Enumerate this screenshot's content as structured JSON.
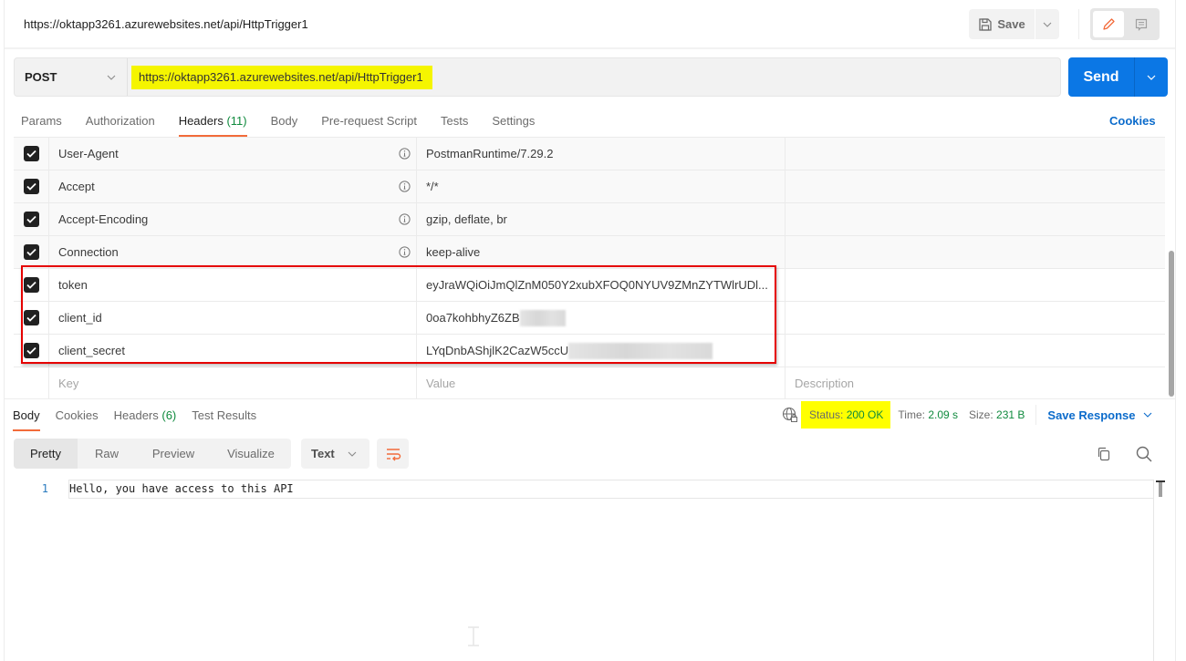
{
  "request": {
    "title": "https://oktapp3261.azurewebsites.net/api/HttpTrigger1",
    "method": "POST",
    "url": "https://oktapp3261.azurewebsites.net/api/HttpTrigger1",
    "save_label": "Save",
    "send_label": "Send",
    "cookies_label": "Cookies",
    "tabs": [
      {
        "label": "Params"
      },
      {
        "label": "Authorization"
      },
      {
        "label": "Headers",
        "count": "(11)",
        "active": true
      },
      {
        "label": "Body"
      },
      {
        "label": "Pre-request Script"
      },
      {
        "label": "Tests"
      },
      {
        "label": "Settings"
      }
    ]
  },
  "headers": {
    "rows": [
      {
        "key": "User-Agent",
        "value": "PostmanRuntime/7.29.2",
        "checked": true,
        "auto": true
      },
      {
        "key": "Accept",
        "value": "*/*",
        "checked": true,
        "auto": true
      },
      {
        "key": "Accept-Encoding",
        "value": "gzip, deflate, br",
        "checked": true,
        "auto": true
      },
      {
        "key": "Connection",
        "value": "keep-alive",
        "checked": true,
        "auto": true
      },
      {
        "key": "token",
        "value": "eyJraWQiOiJmQlZnM050Y2xubXFOQ0NYUV9ZMnZYTWlrUDl...",
        "checked": true
      },
      {
        "key": "client_id",
        "value": "0oa7kohbhyZ6ZB",
        "checked": true,
        "redacted": true
      },
      {
        "key": "client_secret",
        "value": "LYqDnbAShjlK2CazW5ccU",
        "checked": true,
        "redacted": true
      }
    ],
    "placeholders": {
      "key": "Key",
      "value": "Value",
      "description": "Description"
    }
  },
  "response": {
    "tabs": [
      {
        "label": "Body",
        "active": true
      },
      {
        "label": "Cookies"
      },
      {
        "label": "Headers",
        "count": "(6)"
      },
      {
        "label": "Test Results"
      }
    ],
    "status_label": "Status:",
    "status_value": "200 OK",
    "time_label": "Time:",
    "time_value": "2.09 s",
    "size_label": "Size:",
    "size_value": "231 B",
    "save_response_label": "Save Response",
    "views": [
      "Pretty",
      "Raw",
      "Preview",
      "Visualize"
    ],
    "active_view": "Pretty",
    "format": "Text",
    "lines": [
      {
        "number": "1",
        "text": "Hello, you have access to this API"
      }
    ]
  },
  "colors": {
    "accent_orange": "#f26b3a",
    "send_blue": "#0b77e5",
    "link_blue": "#0b6bcb",
    "success_green": "#0f8a3d",
    "highlight_yellow": "#ffff00",
    "annotation_red": "#e50000"
  }
}
